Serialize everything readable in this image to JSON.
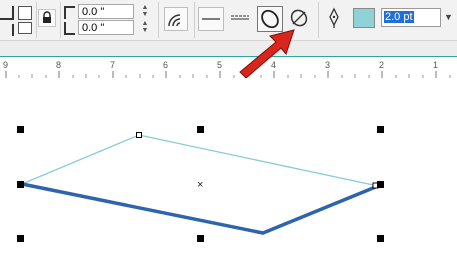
{
  "toolbar": {
    "x_offset": "0.0 \"",
    "y_offset": "0.0 \"",
    "outline_width": "2.0 pt",
    "fill_color": "#8fd3d6"
  },
  "ruler": {
    "labels": [
      "9",
      "8",
      "7",
      "6",
      "5",
      "4",
      "3",
      "2",
      "1"
    ]
  },
  "canvas": {
    "center_marker": "×"
  },
  "colors": {
    "accent_arrow": "#d9261c",
    "selected_line": "#2e63ad",
    "thin_line": "#86ccd6",
    "ruler_border": "#2aa7a0"
  }
}
